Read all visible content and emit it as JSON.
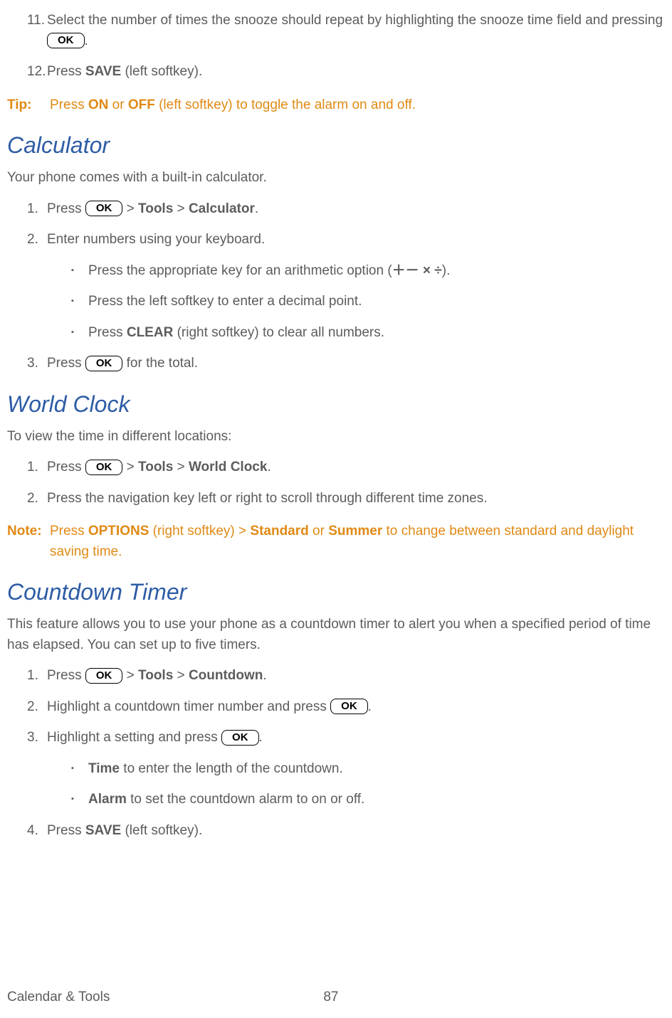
{
  "ok_label": "OK",
  "top_list": {
    "item11": {
      "num": "11.",
      "before": "Select the number of times the snooze should repeat by highlighting the snooze time field and pressing ",
      "after": "."
    },
    "item12": {
      "num": "12.",
      "before": "Press ",
      "b1": "SAVE",
      "after": " (left softkey)."
    }
  },
  "tip": {
    "label": "Tip:",
    "p1": "Press ",
    "b1": "ON",
    "p2": " or ",
    "b2": "OFF",
    "p3": " (left softkey) to toggle the alarm on and off."
  },
  "calc": {
    "heading": "Calculator",
    "intro": "Your phone comes with a built-in calculator.",
    "s1": {
      "num": "1.",
      "before": "Press ",
      "mid": " > ",
      "b1": "Tools",
      "sep": " > ",
      "b2": "Calculator",
      "after": "."
    },
    "s2": {
      "num": "2.",
      "text": "Enter numbers using your keyboard."
    },
    "s2a": {
      "before": "Press the appropriate key for an arithmetic option (",
      "ops": "＋－ × ÷",
      "after": ")."
    },
    "s2b": {
      "text": "Press the left softkey to enter a decimal point."
    },
    "s2c": {
      "before": "Press ",
      "b1": "CLEAR",
      "after": " (right softkey) to clear all numbers."
    },
    "s3": {
      "num": "3.",
      "before": "Press ",
      "after": " for the total."
    }
  },
  "world": {
    "heading": "World Clock",
    "intro": "To view the time in different locations:",
    "s1": {
      "num": "1.",
      "before": "Press ",
      "mid": " > ",
      "b1": "Tools",
      "sep": " > ",
      "b2": "World Clock",
      "after": "."
    },
    "s2": {
      "num": "2.",
      "text": "Press the navigation key left or right to scroll through different time zones."
    }
  },
  "note": {
    "label": "Note:",
    "p1": "Press ",
    "b1": "OPTIONS",
    "p2": " (right softkey) > ",
    "b2": "Standard",
    "p3": " or ",
    "b3": "Summer",
    "p4": " to change between standard and daylight saving time."
  },
  "countdown": {
    "heading": "Countdown Timer",
    "intro": "This feature allows you to use your phone as a countdown timer to alert you when a specified period of time has elapsed. You can set up to five timers.",
    "s1": {
      "num": "1.",
      "before": "Press ",
      "mid": " > ",
      "b1": "Tools",
      "sep": " > ",
      "b2": "Countdown",
      "after": "."
    },
    "s2": {
      "num": "2.",
      "before": "Highlight a countdown timer number and press ",
      "after": "."
    },
    "s3": {
      "num": "3.",
      "before": "Highlight a setting and press ",
      "after": "."
    },
    "s3a": {
      "b1": "Time",
      "after": " to enter the length of the countdown."
    },
    "s3b": {
      "b1": "Alarm",
      "after": " to set the countdown alarm to on or off."
    },
    "s4": {
      "num": "4.",
      "before": "Press ",
      "b1": "SAVE",
      "after": " (left softkey)."
    }
  },
  "footer": {
    "title": "Calendar & Tools",
    "page": "87"
  }
}
